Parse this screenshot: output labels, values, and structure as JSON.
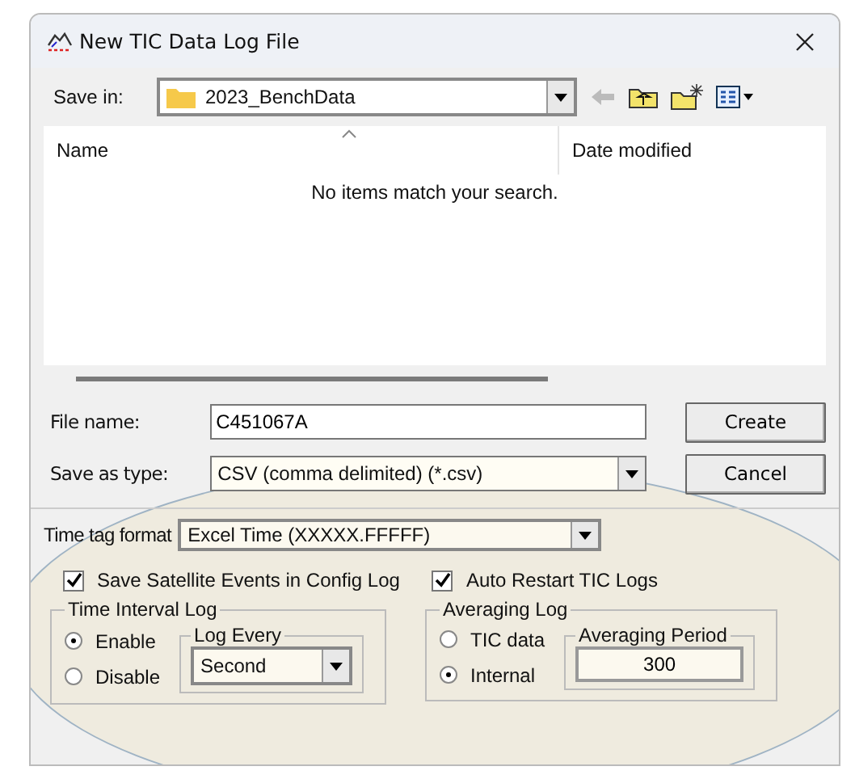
{
  "window": {
    "title": "New TIC Data Log File"
  },
  "save_in": {
    "label": "Save in:",
    "value": "2023_BenchData"
  },
  "file_list": {
    "columns": [
      "Name",
      "Date modified"
    ],
    "empty_message": "No items match your search."
  },
  "file_name": {
    "label": "File name:",
    "value": "C451067A"
  },
  "save_as_type": {
    "label": "Save as type:",
    "value": "CSV (comma delimited) (*.csv)"
  },
  "buttons": [
    "Create",
    "Cancel"
  ],
  "time_tag_format": {
    "label": "Time tag format",
    "value": "Excel Time (XXXXX.FFFFF)"
  },
  "options": [
    {
      "label": "Save Satellite Events in Config Log",
      "checked": true
    },
    {
      "label": "Auto Restart TIC Logs",
      "checked": true
    }
  ],
  "time_interval_log": {
    "title": "Time Interval Log",
    "modes": [
      {
        "label": "Enable",
        "selected": true
      },
      {
        "label": "Disable",
        "selected": false
      }
    ],
    "log_every": {
      "title": "Log Every",
      "value": "Second"
    }
  },
  "averaging_log": {
    "title": "Averaging Log",
    "sources": [
      {
        "label": "TIC data",
        "selected": false
      },
      {
        "label": "Internal",
        "selected": true
      }
    ],
    "averaging_period": {
      "title": "Averaging Period",
      "value": "300"
    }
  }
}
